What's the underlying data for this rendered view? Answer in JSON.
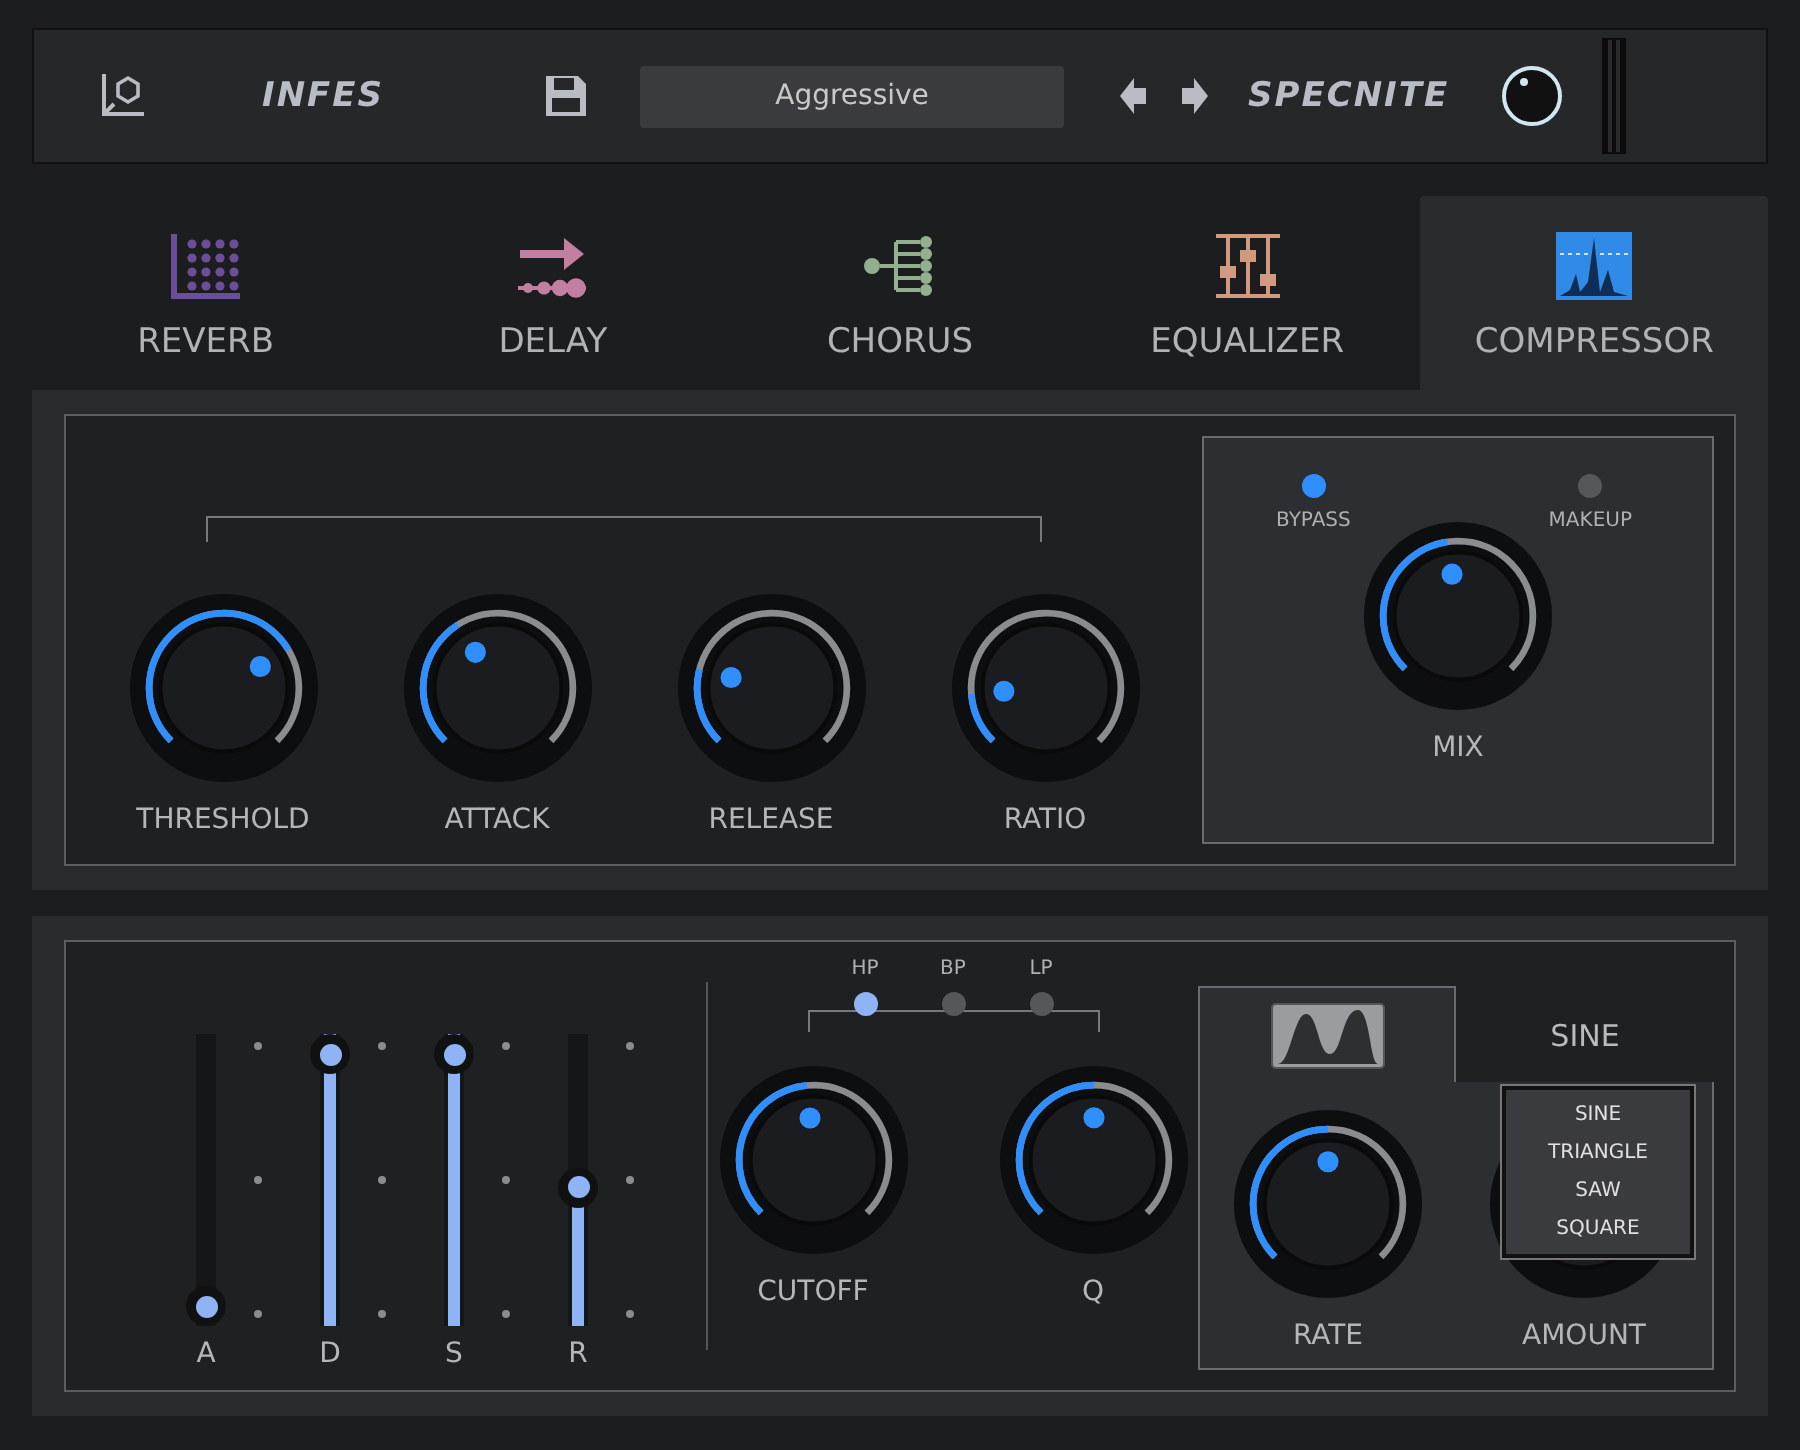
{
  "header": {
    "logo": "INFES",
    "preset": "Aggressive",
    "brand": "SPECNITE"
  },
  "tabs": [
    {
      "label": "REVERB",
      "kind": "reverb",
      "color": "#6a4f98",
      "selected": false
    },
    {
      "label": "DELAY",
      "kind": "delay",
      "color": "#c27fa0",
      "selected": false
    },
    {
      "label": "CHORUS",
      "kind": "chorus",
      "color": "#93b08e",
      "selected": false
    },
    {
      "label": "EQUALIZER",
      "kind": "equalizer",
      "color": "#d19a7e",
      "selected": false
    },
    {
      "label": "COMPRESSOR",
      "kind": "compressor",
      "color": "#2f8ae8",
      "selected": true
    }
  ],
  "compressor": {
    "knobs": [
      {
        "label": "THRESHOLD",
        "level": 0.72
      },
      {
        "label": "ATTACK",
        "level": 0.38
      },
      {
        "label": "RELEASE",
        "level": 0.22
      },
      {
        "label": "RATIO",
        "level": 0.15
      }
    ],
    "mix": {
      "label": "MIX",
      "level": 0.47,
      "options": [
        {
          "label": "BYPASS",
          "selected": true
        },
        {
          "label": "MAKEUP",
          "selected": false
        }
      ]
    }
  },
  "envelope": {
    "sliders": [
      {
        "label": "A",
        "level": 0
      },
      {
        "label": "D",
        "level": 1
      },
      {
        "label": "S",
        "level": 1
      },
      {
        "label": "R",
        "level": 0.47
      }
    ]
  },
  "filter": {
    "modes": [
      {
        "label": "HP",
        "selected": true
      },
      {
        "label": "BP",
        "selected": false
      },
      {
        "label": "LP",
        "selected": false
      }
    ],
    "knobs": [
      {
        "label": "CUTOFF",
        "level": 0.48
      },
      {
        "label": "Q",
        "level": 0.5
      }
    ]
  },
  "lfo": {
    "tabs": [
      {
        "kind": "wave",
        "selected": true
      },
      {
        "kind": "text",
        "label": "SINE",
        "selected": false
      }
    ],
    "rate": {
      "label": "RATE",
      "level": 0.5
    },
    "amount": {
      "label": "AMOUNT"
    },
    "menu": [
      "SINE",
      "TRIANGLE",
      "SAW",
      "SQUARE"
    ]
  }
}
